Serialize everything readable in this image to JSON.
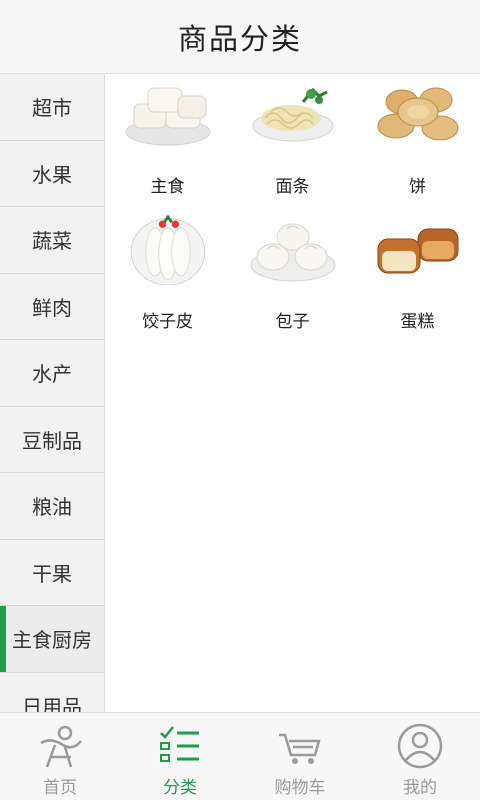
{
  "header": {
    "title": "商品分类"
  },
  "sidebar": {
    "items": [
      {
        "label": "超市"
      },
      {
        "label": "水果"
      },
      {
        "label": "蔬菜"
      },
      {
        "label": "鲜肉"
      },
      {
        "label": "水产"
      },
      {
        "label": "豆制品"
      },
      {
        "label": "粮油"
      },
      {
        "label": "干果"
      },
      {
        "label": "主食厨房"
      },
      {
        "label": "日用品"
      }
    ],
    "active_label": "主食厨房"
  },
  "products": [
    {
      "label": "主食",
      "icon": "steamed-bun-icon"
    },
    {
      "label": "面条",
      "icon": "noodles-icon"
    },
    {
      "label": "饼",
      "icon": "pancake-icon"
    },
    {
      "label": "饺子皮",
      "icon": "dumpling-wrapper-icon"
    },
    {
      "label": "包子",
      "icon": "baozi-icon"
    },
    {
      "label": "蛋糕",
      "icon": "cake-icon"
    }
  ],
  "tabbar": {
    "tabs": [
      {
        "label": "首页",
        "icon": "home-person-icon"
      },
      {
        "label": "分类",
        "icon": "category-list-icon"
      },
      {
        "label": "购物车",
        "icon": "cart-icon"
      },
      {
        "label": "我的",
        "icon": "profile-icon"
      }
    ],
    "active_label": "分类",
    "active_color": "#1f9d4a",
    "inactive_color": "#9a9a9a"
  }
}
